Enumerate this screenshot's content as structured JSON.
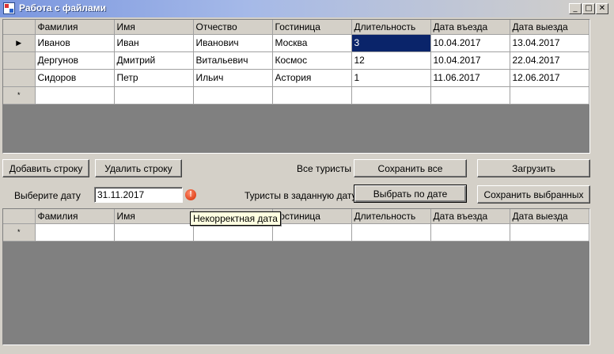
{
  "window": {
    "title": "Работа с файлами",
    "controls": {
      "minimize": "_",
      "maximize": "□",
      "close": "✕"
    }
  },
  "columns": [
    "Фамилия",
    "Имя",
    "Отчество",
    "Гостиница",
    "Длительность",
    "Дата въезда",
    "Дата выезда"
  ],
  "top_grid": {
    "rows": [
      {
        "marker": "▶",
        "cells": [
          "Иванов",
          "Иван",
          "Иванович",
          "Москва",
          "3",
          "10.04.2017",
          "13.04.2017"
        ]
      },
      {
        "marker": "",
        "cells": [
          "Дергунов",
          "Дмитрий",
          "Витальевич",
          "Космос",
          "12",
          "10.04.2017",
          "22.04.2017"
        ]
      },
      {
        "marker": "",
        "cells": [
          "Сидоров",
          "Петр",
          "Ильич",
          "Астория",
          "1",
          "11.06.2017",
          "12.06.2017"
        ]
      }
    ],
    "new_row_marker": "*",
    "selected_cell": "Длительность (row 1)"
  },
  "bottom_grid": {
    "rows": [],
    "new_row_marker": "*"
  },
  "buttons": {
    "add_row": "Добавить строку",
    "delete_row": "Удалить строку",
    "save_all": "Сохранить все",
    "load": "Загрузить",
    "select_by_date": "Выбрать по дате",
    "save_selected": "Сохранить выбранных"
  },
  "labels": {
    "all_tourists": "Все туристы",
    "choose_date": "Выберите дату",
    "tourists_by_date": "Туристы в заданную дату"
  },
  "date_input": {
    "value": "31.11.2017"
  },
  "error": {
    "icon": "!",
    "tooltip": "Некорректная дата"
  }
}
